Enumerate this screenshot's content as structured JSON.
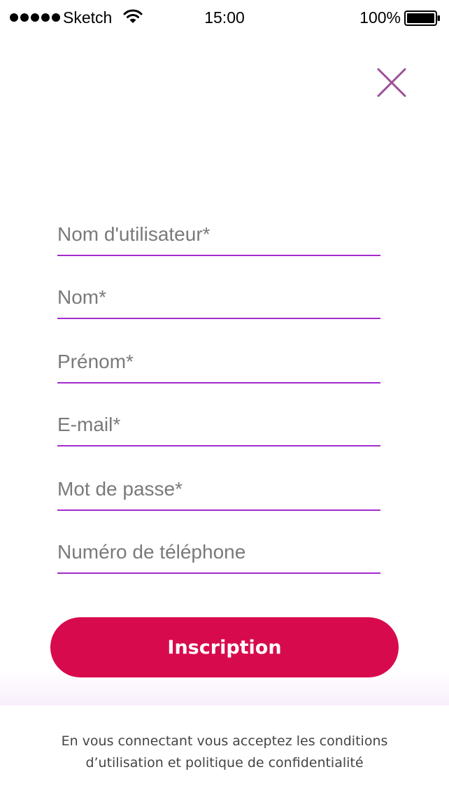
{
  "status_bar": {
    "carrier": "Sketch",
    "time": "15:00",
    "battery": "100%"
  },
  "icons": {
    "close": "close-icon",
    "wifi": "wifi-icon",
    "battery": "battery-icon",
    "signal": "signal-icon"
  },
  "colors": {
    "accent": "#a32ccd",
    "button": "#d80a4e",
    "close": "#9c5196"
  },
  "form": {
    "fields": [
      {
        "placeholder": "Nom d'utilisateur*",
        "value": ""
      },
      {
        "placeholder": "Nom*",
        "value": ""
      },
      {
        "placeholder": "Prénom*",
        "value": ""
      },
      {
        "placeholder": "E-mail*",
        "value": ""
      },
      {
        "placeholder": "Mot de passe*",
        "value": ""
      },
      {
        "placeholder": "Numéro de téléphone",
        "value": ""
      }
    ],
    "submit_label": "Inscription"
  },
  "footer": {
    "line1": "En vous connectant vous acceptez les conditions",
    "line2": "d’utilisation et politique de confidentialité"
  }
}
